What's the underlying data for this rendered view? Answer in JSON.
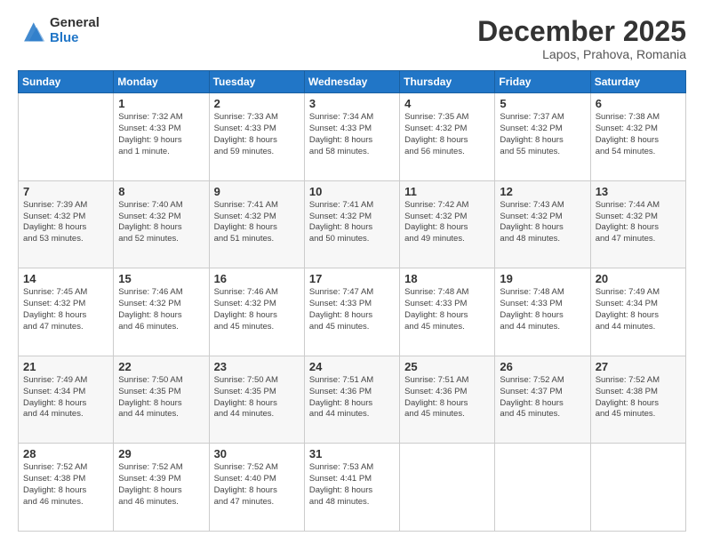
{
  "logo": {
    "general": "General",
    "blue": "Blue"
  },
  "header": {
    "month": "December 2025",
    "location": "Lapos, Prahova, Romania"
  },
  "weekdays": [
    "Sunday",
    "Monday",
    "Tuesday",
    "Wednesday",
    "Thursday",
    "Friday",
    "Saturday"
  ],
  "weeks": [
    [
      {
        "day": "",
        "info": ""
      },
      {
        "day": "1",
        "info": "Sunrise: 7:32 AM\nSunset: 4:33 PM\nDaylight: 9 hours\nand 1 minute."
      },
      {
        "day": "2",
        "info": "Sunrise: 7:33 AM\nSunset: 4:33 PM\nDaylight: 8 hours\nand 59 minutes."
      },
      {
        "day": "3",
        "info": "Sunrise: 7:34 AM\nSunset: 4:33 PM\nDaylight: 8 hours\nand 58 minutes."
      },
      {
        "day": "4",
        "info": "Sunrise: 7:35 AM\nSunset: 4:32 PM\nDaylight: 8 hours\nand 56 minutes."
      },
      {
        "day": "5",
        "info": "Sunrise: 7:37 AM\nSunset: 4:32 PM\nDaylight: 8 hours\nand 55 minutes."
      },
      {
        "day": "6",
        "info": "Sunrise: 7:38 AM\nSunset: 4:32 PM\nDaylight: 8 hours\nand 54 minutes."
      }
    ],
    [
      {
        "day": "7",
        "info": "Sunrise: 7:39 AM\nSunset: 4:32 PM\nDaylight: 8 hours\nand 53 minutes."
      },
      {
        "day": "8",
        "info": "Sunrise: 7:40 AM\nSunset: 4:32 PM\nDaylight: 8 hours\nand 52 minutes."
      },
      {
        "day": "9",
        "info": "Sunrise: 7:41 AM\nSunset: 4:32 PM\nDaylight: 8 hours\nand 51 minutes."
      },
      {
        "day": "10",
        "info": "Sunrise: 7:41 AM\nSunset: 4:32 PM\nDaylight: 8 hours\nand 50 minutes."
      },
      {
        "day": "11",
        "info": "Sunrise: 7:42 AM\nSunset: 4:32 PM\nDaylight: 8 hours\nand 49 minutes."
      },
      {
        "day": "12",
        "info": "Sunrise: 7:43 AM\nSunset: 4:32 PM\nDaylight: 8 hours\nand 48 minutes."
      },
      {
        "day": "13",
        "info": "Sunrise: 7:44 AM\nSunset: 4:32 PM\nDaylight: 8 hours\nand 47 minutes."
      }
    ],
    [
      {
        "day": "14",
        "info": "Sunrise: 7:45 AM\nSunset: 4:32 PM\nDaylight: 8 hours\nand 47 minutes."
      },
      {
        "day": "15",
        "info": "Sunrise: 7:46 AM\nSunset: 4:32 PM\nDaylight: 8 hours\nand 46 minutes."
      },
      {
        "day": "16",
        "info": "Sunrise: 7:46 AM\nSunset: 4:32 PM\nDaylight: 8 hours\nand 45 minutes."
      },
      {
        "day": "17",
        "info": "Sunrise: 7:47 AM\nSunset: 4:33 PM\nDaylight: 8 hours\nand 45 minutes."
      },
      {
        "day": "18",
        "info": "Sunrise: 7:48 AM\nSunset: 4:33 PM\nDaylight: 8 hours\nand 45 minutes."
      },
      {
        "day": "19",
        "info": "Sunrise: 7:48 AM\nSunset: 4:33 PM\nDaylight: 8 hours\nand 44 minutes."
      },
      {
        "day": "20",
        "info": "Sunrise: 7:49 AM\nSunset: 4:34 PM\nDaylight: 8 hours\nand 44 minutes."
      }
    ],
    [
      {
        "day": "21",
        "info": "Sunrise: 7:49 AM\nSunset: 4:34 PM\nDaylight: 8 hours\nand 44 minutes."
      },
      {
        "day": "22",
        "info": "Sunrise: 7:50 AM\nSunset: 4:35 PM\nDaylight: 8 hours\nand 44 minutes."
      },
      {
        "day": "23",
        "info": "Sunrise: 7:50 AM\nSunset: 4:35 PM\nDaylight: 8 hours\nand 44 minutes."
      },
      {
        "day": "24",
        "info": "Sunrise: 7:51 AM\nSunset: 4:36 PM\nDaylight: 8 hours\nand 44 minutes."
      },
      {
        "day": "25",
        "info": "Sunrise: 7:51 AM\nSunset: 4:36 PM\nDaylight: 8 hours\nand 45 minutes."
      },
      {
        "day": "26",
        "info": "Sunrise: 7:52 AM\nSunset: 4:37 PM\nDaylight: 8 hours\nand 45 minutes."
      },
      {
        "day": "27",
        "info": "Sunrise: 7:52 AM\nSunset: 4:38 PM\nDaylight: 8 hours\nand 45 minutes."
      }
    ],
    [
      {
        "day": "28",
        "info": "Sunrise: 7:52 AM\nSunset: 4:38 PM\nDaylight: 8 hours\nand 46 minutes."
      },
      {
        "day": "29",
        "info": "Sunrise: 7:52 AM\nSunset: 4:39 PM\nDaylight: 8 hours\nand 46 minutes."
      },
      {
        "day": "30",
        "info": "Sunrise: 7:52 AM\nSunset: 4:40 PM\nDaylight: 8 hours\nand 47 minutes."
      },
      {
        "day": "31",
        "info": "Sunrise: 7:53 AM\nSunset: 4:41 PM\nDaylight: 8 hours\nand 48 minutes."
      },
      {
        "day": "",
        "info": ""
      },
      {
        "day": "",
        "info": ""
      },
      {
        "day": "",
        "info": ""
      }
    ]
  ]
}
